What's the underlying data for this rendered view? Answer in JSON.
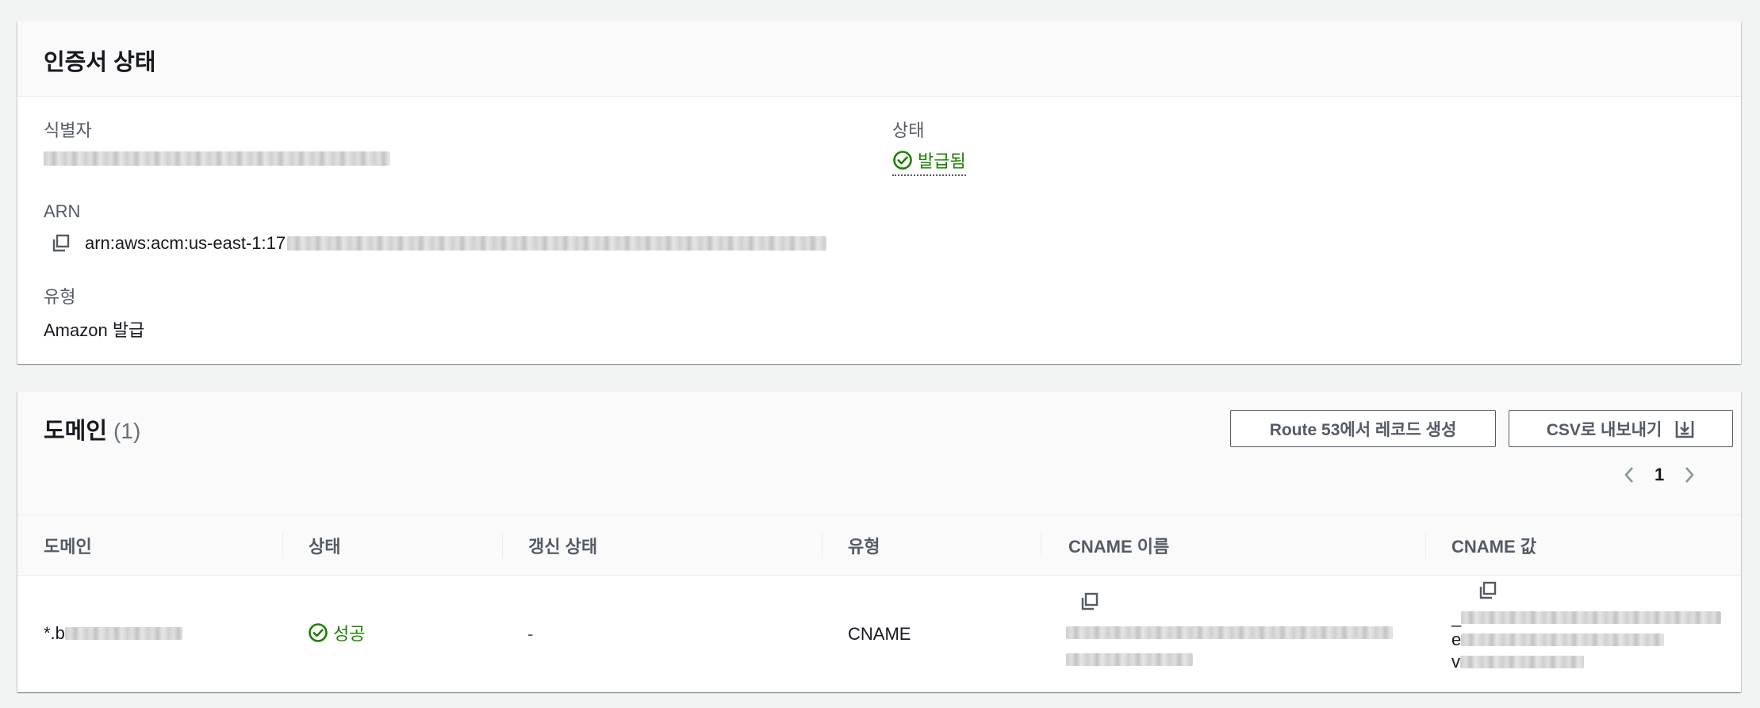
{
  "certificate_status": {
    "title": "인증서 상태",
    "identifier_label": "식별자",
    "status_label": "상태",
    "status_value": "발급됨",
    "arn_label": "ARN",
    "arn_prefix": "arn:aws:acm:us-east-1:17",
    "type_label": "유형",
    "type_value": "Amazon 발급"
  },
  "domains": {
    "title": "도메인",
    "count": "(1)",
    "route53_button": "Route 53에서 레코드 생성",
    "csv_button": "CSV로 내보내기",
    "pagination": {
      "current_page": "1"
    },
    "columns": [
      "도메인",
      "상태",
      "갱신 상태",
      "유형",
      "CNAME 이름",
      "CNAME 값"
    ],
    "rows": [
      {
        "domain_prefix": "*.b",
        "status": "성공",
        "renewal_status": "-",
        "type": "CNAME",
        "cname_value_line1": "_",
        "cname_value_line2": "e",
        "cname_value_line3": "v"
      }
    ]
  },
  "colors": {
    "success": "#1d8102",
    "text_secondary": "#545b64",
    "background": "#f2f3f3"
  }
}
